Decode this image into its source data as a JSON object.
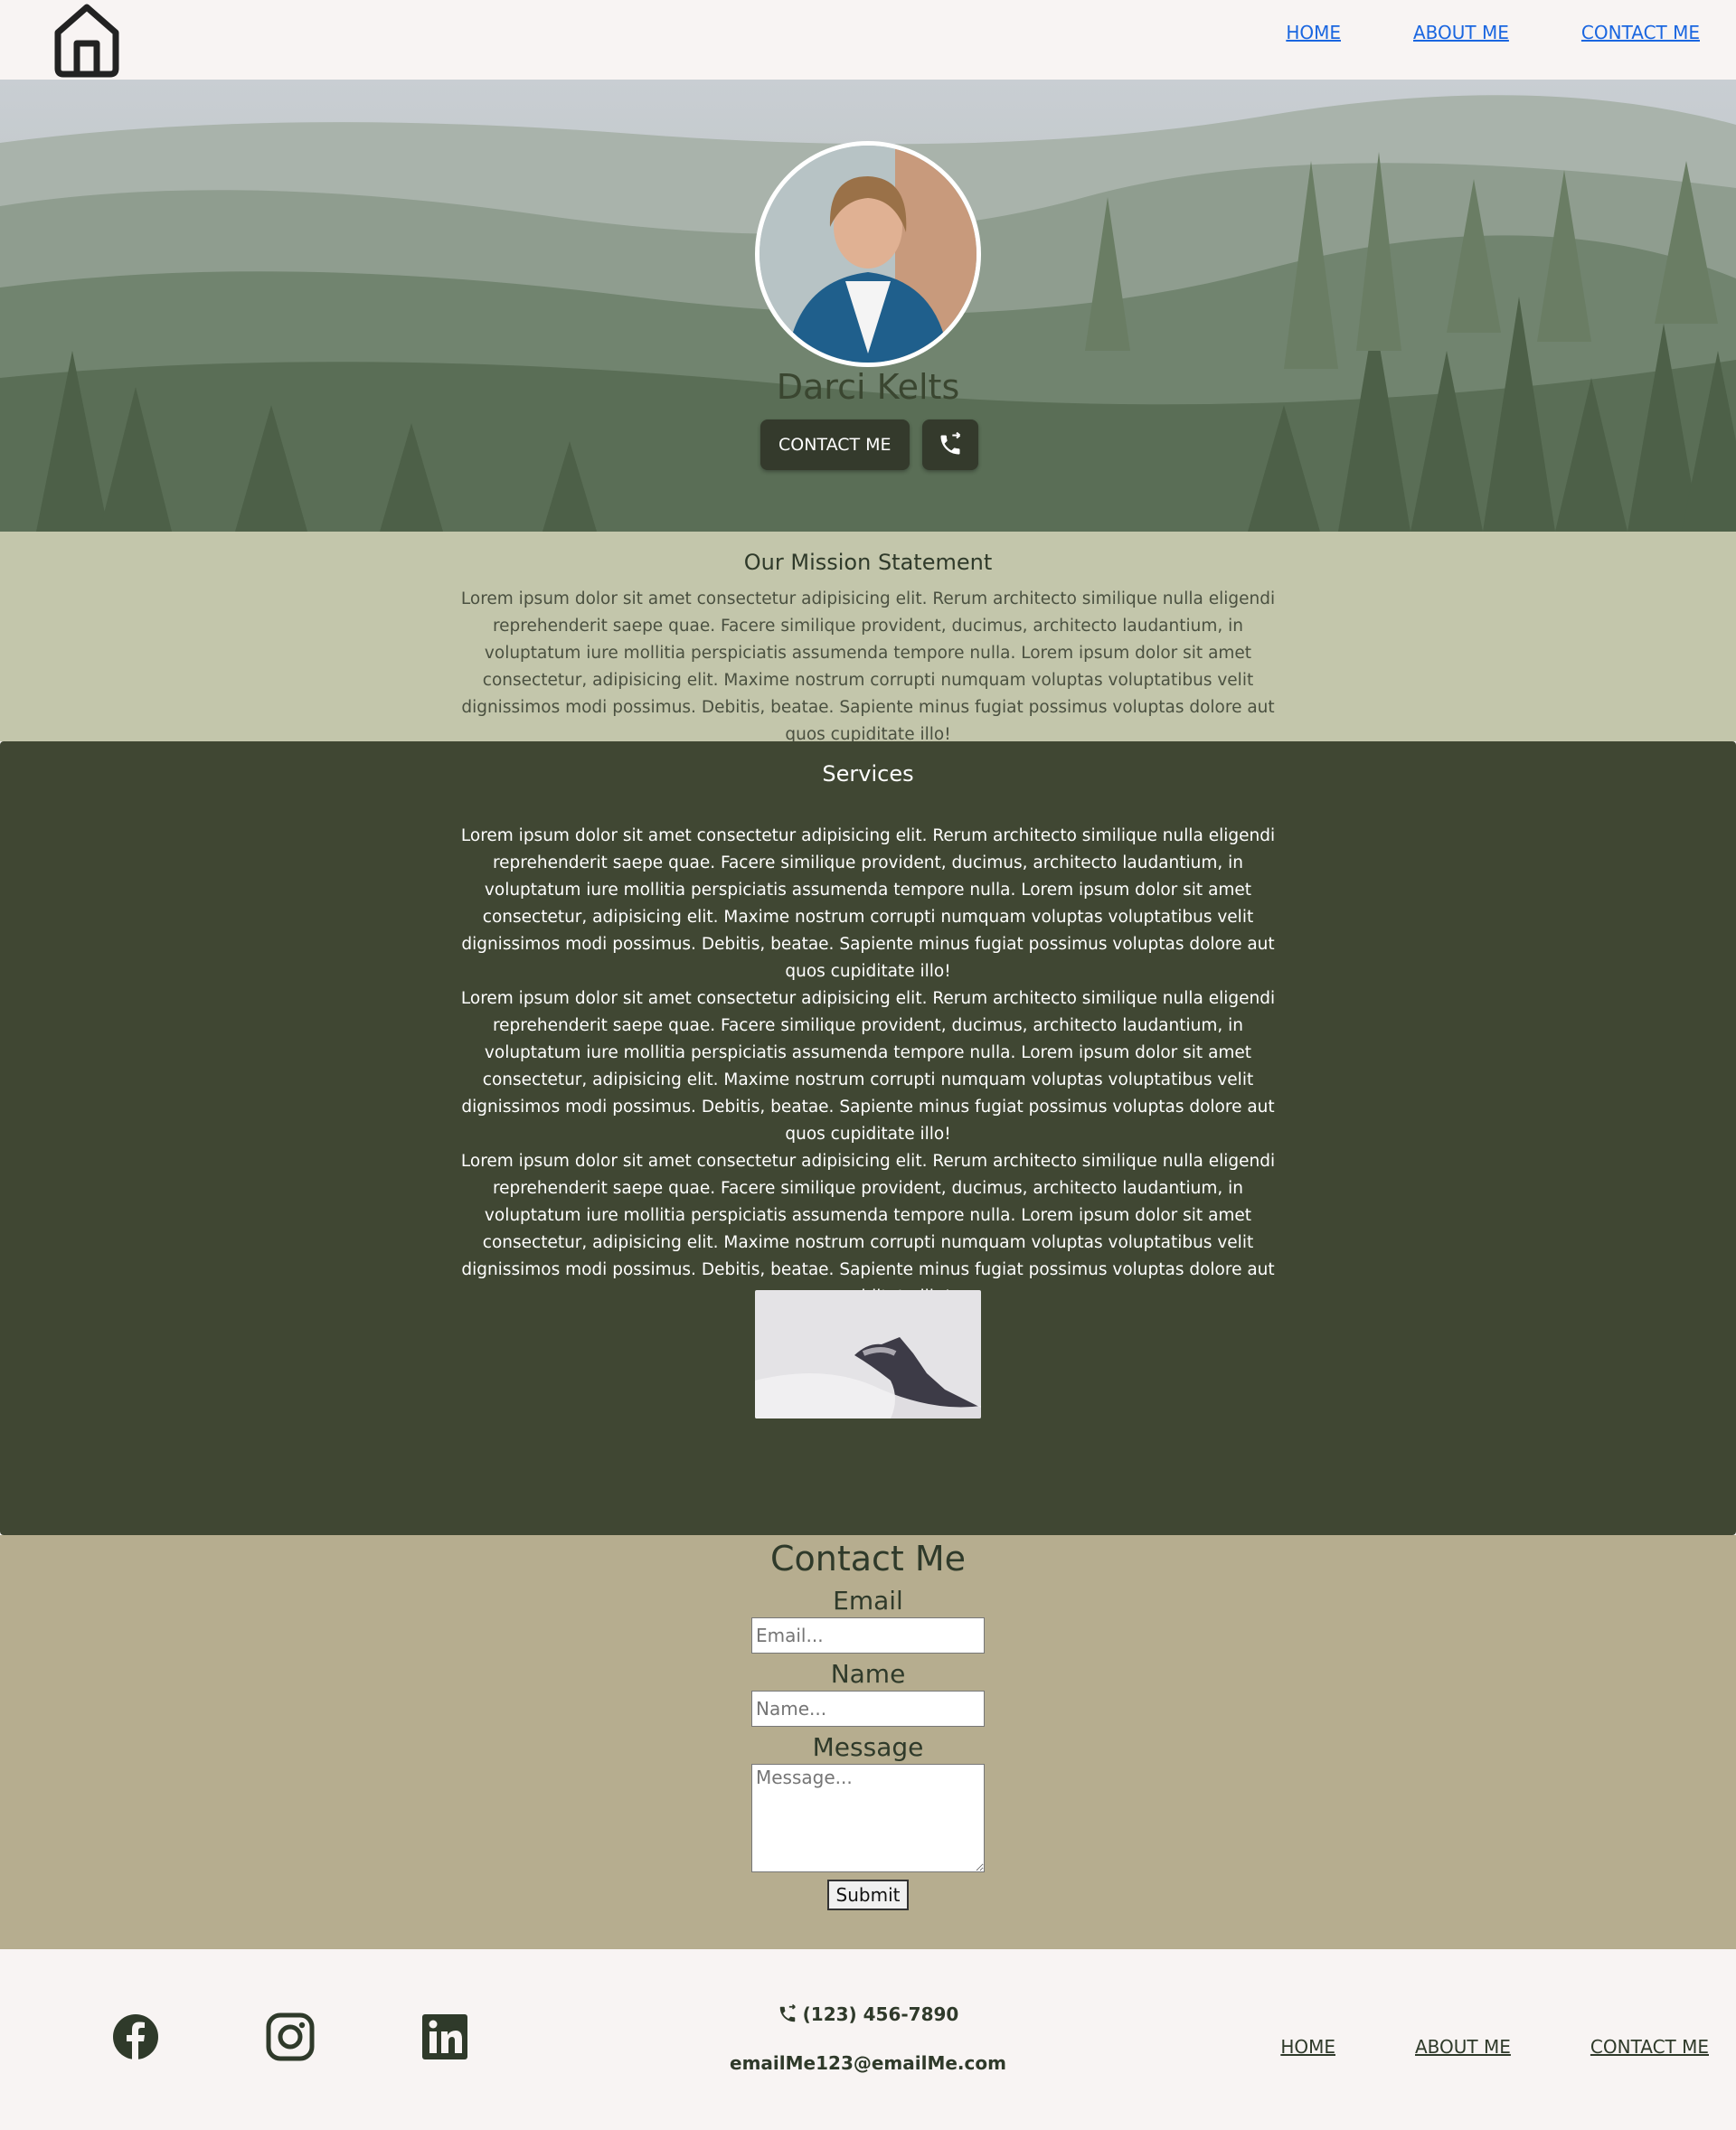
{
  "nav": {
    "logo_icon": "home-icon",
    "links": [
      "HOME",
      "ABOUT ME",
      "CONTACT ME"
    ]
  },
  "hero": {
    "name": "Darci Kelts",
    "contact_button": "CONTACT ME",
    "phone_button_icon": "phone-icon"
  },
  "mission": {
    "title": "Our Mission Statement",
    "text": "Lorem ipsum dolor sit amet consectetur adipisicing elit. Rerum architecto similique nulla eligendi reprehenderit saepe quae. Facere similique provident, ducimus, architecto laudantium, in voluptatum iure mollitia perspiciatis assumenda tempore nulla. Lorem ipsum dolor sit amet consectetur, adipisicing elit. Maxime nostrum corrupti numquam voluptas voluptatibus velit dignissimos modi possimus. Debitis, beatae. Sapiente minus fugiat possimus voluptas dolore aut quos cupiditate illo!"
  },
  "services": {
    "title": "Services",
    "paragraphs": [
      "Lorem ipsum dolor sit amet consectetur adipisicing elit. Rerum architecto similique nulla eligendi reprehenderit saepe quae. Facere similique provident, ducimus, architecto laudantium, in voluptatum iure mollitia perspiciatis assumenda tempore nulla. Lorem ipsum dolor sit amet consectetur, adipisicing elit. Maxime nostrum corrupti numquam voluptas voluptatibus velit dignissimos modi possimus. Debitis, beatae. Sapiente minus fugiat possimus voluptas dolore aut quos cupiditate illo!",
      "Lorem ipsum dolor sit amet consectetur adipisicing elit. Rerum architecto similique nulla eligendi reprehenderit saepe quae. Facere similique provident, ducimus, architecto laudantium, in voluptatum iure mollitia perspiciatis assumenda tempore nulla. Lorem ipsum dolor sit amet consectetur, adipisicing elit. Maxime nostrum corrupti numquam voluptas voluptatibus velit dignissimos modi possimus. Debitis, beatae. Sapiente minus fugiat possimus voluptas dolore aut quos cupiditate illo!",
      "Lorem ipsum dolor sit amet consectetur adipisicing elit. Rerum architecto similique nulla eligendi reprehenderit saepe quae. Facere similique provident, ducimus, architecto laudantium, in voluptatum iure mollitia perspiciatis assumenda tempore nulla. Lorem ipsum dolor sit amet consectetur, adipisicing elit. Maxime nostrum corrupti numquam voluptas voluptatibus velit dignissimos modi possimus. Debitis, beatae. Sapiente minus fugiat possimus voluptas dolore aut quos cupiditate illo!"
    ]
  },
  "contact": {
    "title": "Contact Me",
    "email_label": "Email",
    "email_placeholder": "Email...",
    "name_label": "Name",
    "name_placeholder": "Name...",
    "message_label": "Message",
    "message_placeholder": "Message...",
    "submit_label": "Submit"
  },
  "footer": {
    "social_icons": [
      "facebook-icon",
      "instagram-icon",
      "linkedin-icon"
    ],
    "phone": "(123) 456-7890",
    "email": "emailMe123@emailMe.com",
    "links": [
      "HOME",
      "ABOUT ME",
      "CONTACT ME"
    ]
  },
  "colors": {
    "nav_bg": "#f8f4f3",
    "link_blue": "#1a66e0",
    "mission_bg": "#c3c6ab",
    "services_bg": "#404733",
    "contact_bg": "#b6ad8f",
    "button_dark": "#343a2c"
  }
}
